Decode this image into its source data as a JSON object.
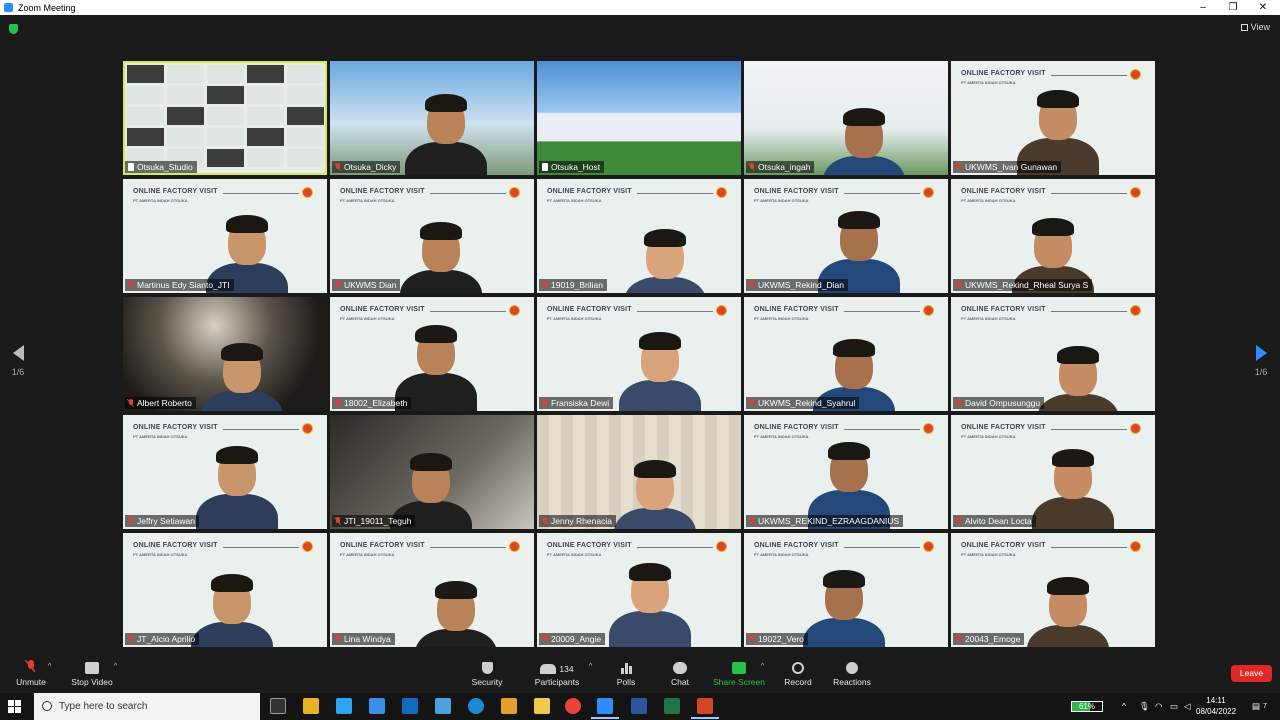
{
  "window": {
    "title": "Zoom Meeting"
  },
  "top_right": {
    "view_label": "View"
  },
  "pager": {
    "left_label": "1/6",
    "right_label": "1/6"
  },
  "slide_title": "ONLINE FACTORY VISIT",
  "slide_subtitle": "PT AMERTA INDAH OTSUKA",
  "participants": [
    {
      "name": "Otsuka_Studio",
      "muted": false,
      "kind": "gallery"
    },
    {
      "name": "Otsuka_Dicky",
      "muted": true,
      "kind": "camera"
    },
    {
      "name": "Otsuka_Host",
      "muted": false,
      "kind": "building"
    },
    {
      "name": "Otsuka_ingah",
      "muted": true,
      "kind": "camera"
    },
    {
      "name": "UKWMS_Ivan Gunawan",
      "muted": true,
      "kind": "slide"
    },
    {
      "name": "Martinus Edy Sianto_JTI",
      "muted": true,
      "kind": "slide"
    },
    {
      "name": "UKWMS Dian",
      "muted": true,
      "kind": "slide"
    },
    {
      "name": "19019_Brilian",
      "muted": true,
      "kind": "slide"
    },
    {
      "name": "UKWMS_Rekind_Dian",
      "muted": true,
      "kind": "slide"
    },
    {
      "name": "UKWMS_Rekind_Rheal Surya S",
      "muted": true,
      "kind": "slide"
    },
    {
      "name": "Albert Roberto",
      "muted": true,
      "kind": "dark"
    },
    {
      "name": "18002_Elizabeth",
      "muted": true,
      "kind": "slide"
    },
    {
      "name": "Fransiska Dewi",
      "muted": true,
      "kind": "slide"
    },
    {
      "name": "UKWMS_Rekind_Syahrul",
      "muted": true,
      "kind": "slide"
    },
    {
      "name": "David Ompusunggu",
      "muted": true,
      "kind": "slide"
    },
    {
      "name": "Jeffry Setiawan",
      "muted": true,
      "kind": "slide"
    },
    {
      "name": "JTI_19011_Teguh",
      "muted": true,
      "kind": "dark"
    },
    {
      "name": "Jenny Rhenacia",
      "muted": true,
      "kind": "room"
    },
    {
      "name": "UKWMS_REKIND_EZRAAGDANIUS",
      "muted": true,
      "kind": "slide"
    },
    {
      "name": "Alvito Dean Locta",
      "muted": true,
      "kind": "slide"
    },
    {
      "name": "JT_Alcio Aprilio",
      "muted": true,
      "kind": "slide"
    },
    {
      "name": "Lina Windya",
      "muted": true,
      "kind": "slide"
    },
    {
      "name": "20009_Angie",
      "muted": true,
      "kind": "slide"
    },
    {
      "name": "19022_Vero",
      "muted": true,
      "kind": "slide"
    },
    {
      "name": "20043_Emoge",
      "muted": true,
      "kind": "slide"
    }
  ],
  "toolbar": {
    "unmute": "Unmute",
    "stop_video": "Stop Video",
    "security": "Security",
    "participants": "Participants",
    "participants_count": "134",
    "polls": "Polls",
    "chat": "Chat",
    "share_screen": "Share Screen",
    "record": "Record",
    "reactions": "Reactions",
    "leave": "Leave"
  },
  "taskbar": {
    "search_placeholder": "Type here to search",
    "battery": "61%",
    "battery_level": 0.61,
    "time": "14:11",
    "date": "08/04/2022",
    "notification_count": "7"
  },
  "colors": {
    "share_green": "#23c249",
    "leave_red": "#e02828",
    "active_speaker": "#d7e94b",
    "zoom_blue": "#2d8cff"
  }
}
